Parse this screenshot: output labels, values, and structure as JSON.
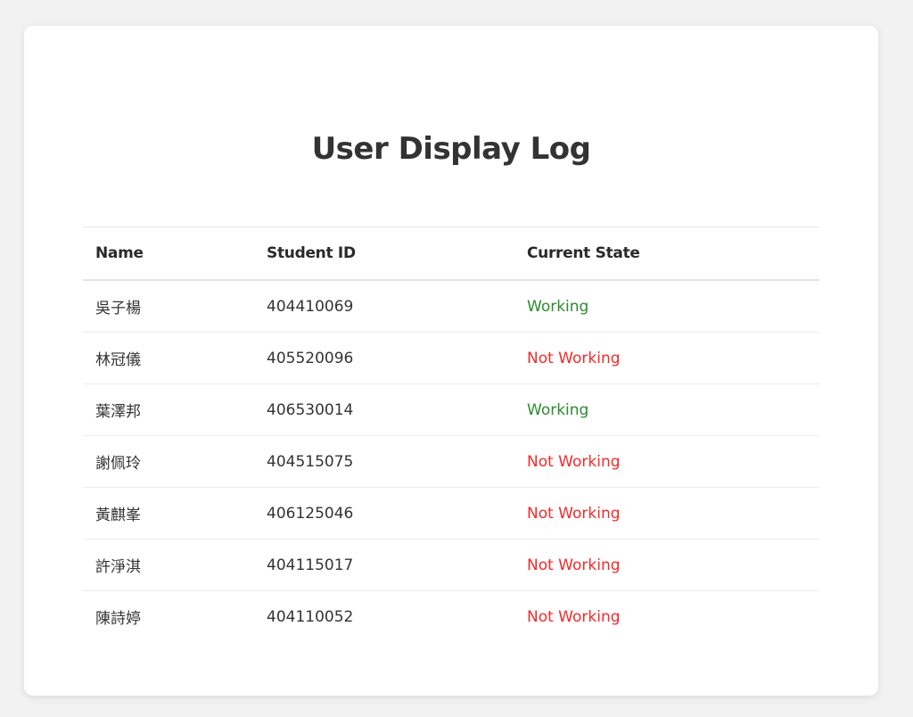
{
  "page": {
    "title": "User Display Log"
  },
  "table": {
    "headers": {
      "name": "Name",
      "student_id": "Student ID",
      "state": "Current State"
    },
    "rows": [
      {
        "name": "吳子楊",
        "student_id": "404410069",
        "state": "Working"
      },
      {
        "name": "林冠儀",
        "student_id": "405520096",
        "state": "Not Working"
      },
      {
        "name": "葉澤邦",
        "student_id": "406530014",
        "state": "Working"
      },
      {
        "name": "謝佩玲",
        "student_id": "404515075",
        "state": "Not Working"
      },
      {
        "name": "黃麒峯",
        "student_id": "406125046",
        "state": "Not Working"
      },
      {
        "name": "許淨淇",
        "student_id": "404115017",
        "state": "Not Working"
      },
      {
        "name": "陳詩婷",
        "student_id": "404110052",
        "state": "Not Working"
      }
    ]
  },
  "colors": {
    "name_link": "#1f7ae0",
    "working": "#2e8b2e",
    "not_working": "#f22a2a",
    "background": "#f2f2f2",
    "card": "#ffffff"
  }
}
